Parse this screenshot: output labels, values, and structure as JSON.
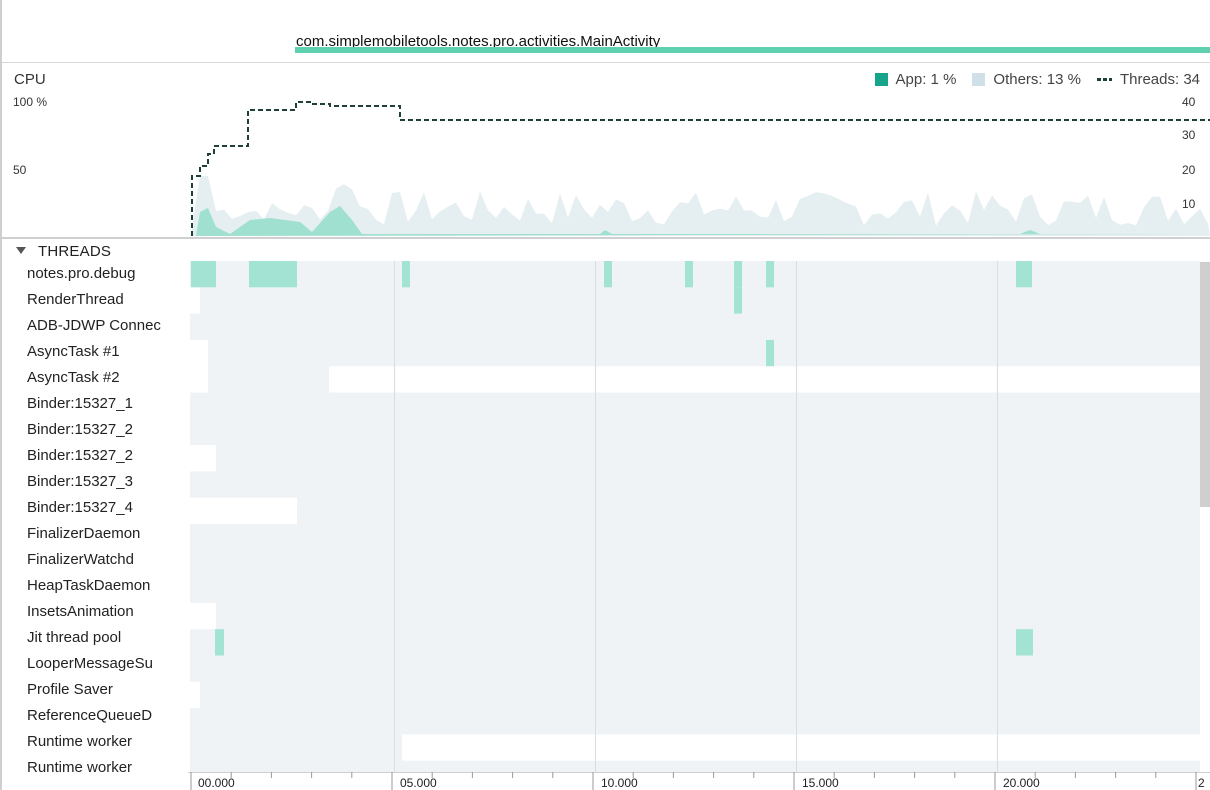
{
  "activity": {
    "label": "com.simplemobiletools.notes.pro.activities.MainActivity",
    "color": "#5fd1b1"
  },
  "cpu": {
    "title": "CPU",
    "legend": {
      "app": "App: 1 %",
      "others": "Others: 13 %",
      "threads": "Threads: 34"
    },
    "left_axis": [
      "100 %",
      "50"
    ],
    "right_axis": [
      "40",
      "30",
      "20",
      "10"
    ],
    "colors": {
      "app": "#9fe0d0",
      "app_swatch": "#16a58a",
      "others": "#e5eef1",
      "others_swatch": "#cfe0e8",
      "threads_line": "#1f3f3a"
    }
  },
  "threads_section": {
    "title": "THREADS"
  },
  "threads": [
    {
      "name": "notes.pro.debug"
    },
    {
      "name": "RenderThread"
    },
    {
      "name": "ADB-JDWP Connec"
    },
    {
      "name": "AsyncTask #1"
    },
    {
      "name": "AsyncTask #2"
    },
    {
      "name": "Binder:15327_1"
    },
    {
      "name": "Binder:15327_2"
    },
    {
      "name": "Binder:15327_2"
    },
    {
      "name": "Binder:15327_3"
    },
    {
      "name": "Binder:15327_4"
    },
    {
      "name": "FinalizerDaemon"
    },
    {
      "name": "FinalizerWatchd"
    },
    {
      "name": "HeapTaskDaemon"
    },
    {
      "name": "InsetsAnimation"
    },
    {
      "name": "Jit thread pool"
    },
    {
      "name": "LooperMessageSu"
    },
    {
      "name": "Profile Saver"
    },
    {
      "name": "ReferenceQueueD"
    },
    {
      "name": "Runtime worker"
    },
    {
      "name": "Runtime worker"
    }
  ],
  "timeline": {
    "tick_labels": [
      "00.000",
      "05.000",
      "10.000",
      "15.000",
      "20.000",
      "2"
    ]
  }
}
